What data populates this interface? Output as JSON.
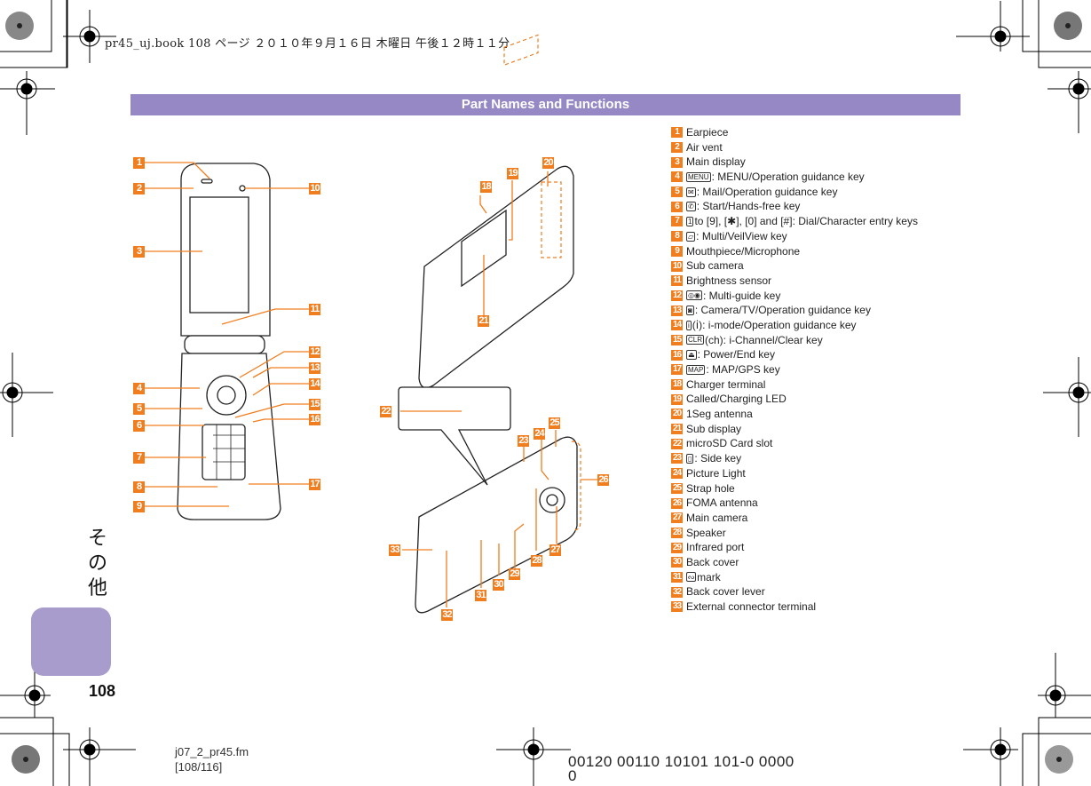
{
  "print_header": "pr45_uj.book  108 ページ  ２０１０年９月１６日  木曜日  午後１２時１１分",
  "section_title": "Part Names and Functions",
  "side_tab_label": [
    "そ",
    "の",
    "他"
  ],
  "page_number": "108",
  "footer": {
    "filename": "j07_2_pr45.fm",
    "page_ref": "[108/116]",
    "code_line1": "00120 00110 10101 101-0 0000",
    "code_line2": "0"
  },
  "accent_color": "#f07d1e",
  "title_bar_color": "#9688c4",
  "parts": [
    {
      "num": "1",
      "label": "Earpiece"
    },
    {
      "num": "2",
      "label": "Air vent"
    },
    {
      "num": "3",
      "label": "Main display"
    },
    {
      "num": "4",
      "key": "MENU",
      "label": ": MENU/Operation guidance key"
    },
    {
      "num": "5",
      "key": "✉",
      "label": ": Mail/Operation guidance key"
    },
    {
      "num": "6",
      "key": "✆",
      "label": ": Start/Hands-free key"
    },
    {
      "num": "7",
      "key": "1",
      "label": " to [9], [✱], [0] and [#]: Dial/Character entry keys"
    },
    {
      "num": "8",
      "key": "▱",
      "label": ": Multi/VeilView key"
    },
    {
      "num": "9",
      "label": "Mouthpiece/Microphone"
    },
    {
      "num": "10",
      "label": "Sub camera"
    },
    {
      "num": "11",
      "label": "Brightness sensor"
    },
    {
      "num": "12",
      "key": "◎◉",
      "label": ": Multi-guide key"
    },
    {
      "num": "13",
      "key": "◙",
      "label": ": Camera/TV/Operation guidance key"
    },
    {
      "num": "14",
      "key": "i",
      "label": " (ⅰ): i-mode/Operation guidance key"
    },
    {
      "num": "15",
      "key": "CLR",
      "label": " (ch): i-Channel/Clear key"
    },
    {
      "num": "16",
      "key": "⏏",
      "label": ": Power/End key"
    },
    {
      "num": "17",
      "key": "MAP",
      "label": ": MAP/GPS key"
    },
    {
      "num": "18",
      "label": "Charger terminal"
    },
    {
      "num": "19",
      "label": "Called/Charging LED"
    },
    {
      "num": "20",
      "label": "1Seg antenna"
    },
    {
      "num": "21",
      "label": "Sub display"
    },
    {
      "num": "22",
      "label": "microSD Card slot"
    },
    {
      "num": "23",
      "key": "▯",
      "label": ": Side key"
    },
    {
      "num": "24",
      "label": "Picture Light"
    },
    {
      "num": "25",
      "label": "Strap hole"
    },
    {
      "num": "26",
      "label": "FOMA antenna"
    },
    {
      "num": "27",
      "label": "Main camera"
    },
    {
      "num": "28",
      "label": "Speaker"
    },
    {
      "num": "29",
      "label": "Infrared port"
    },
    {
      "num": "30",
      "label": "Back cover"
    },
    {
      "num": "31",
      "key": "ᔓ",
      "label": " mark"
    },
    {
      "num": "32",
      "label": "Back cover lever"
    },
    {
      "num": "33",
      "label": "External connector terminal"
    }
  ]
}
